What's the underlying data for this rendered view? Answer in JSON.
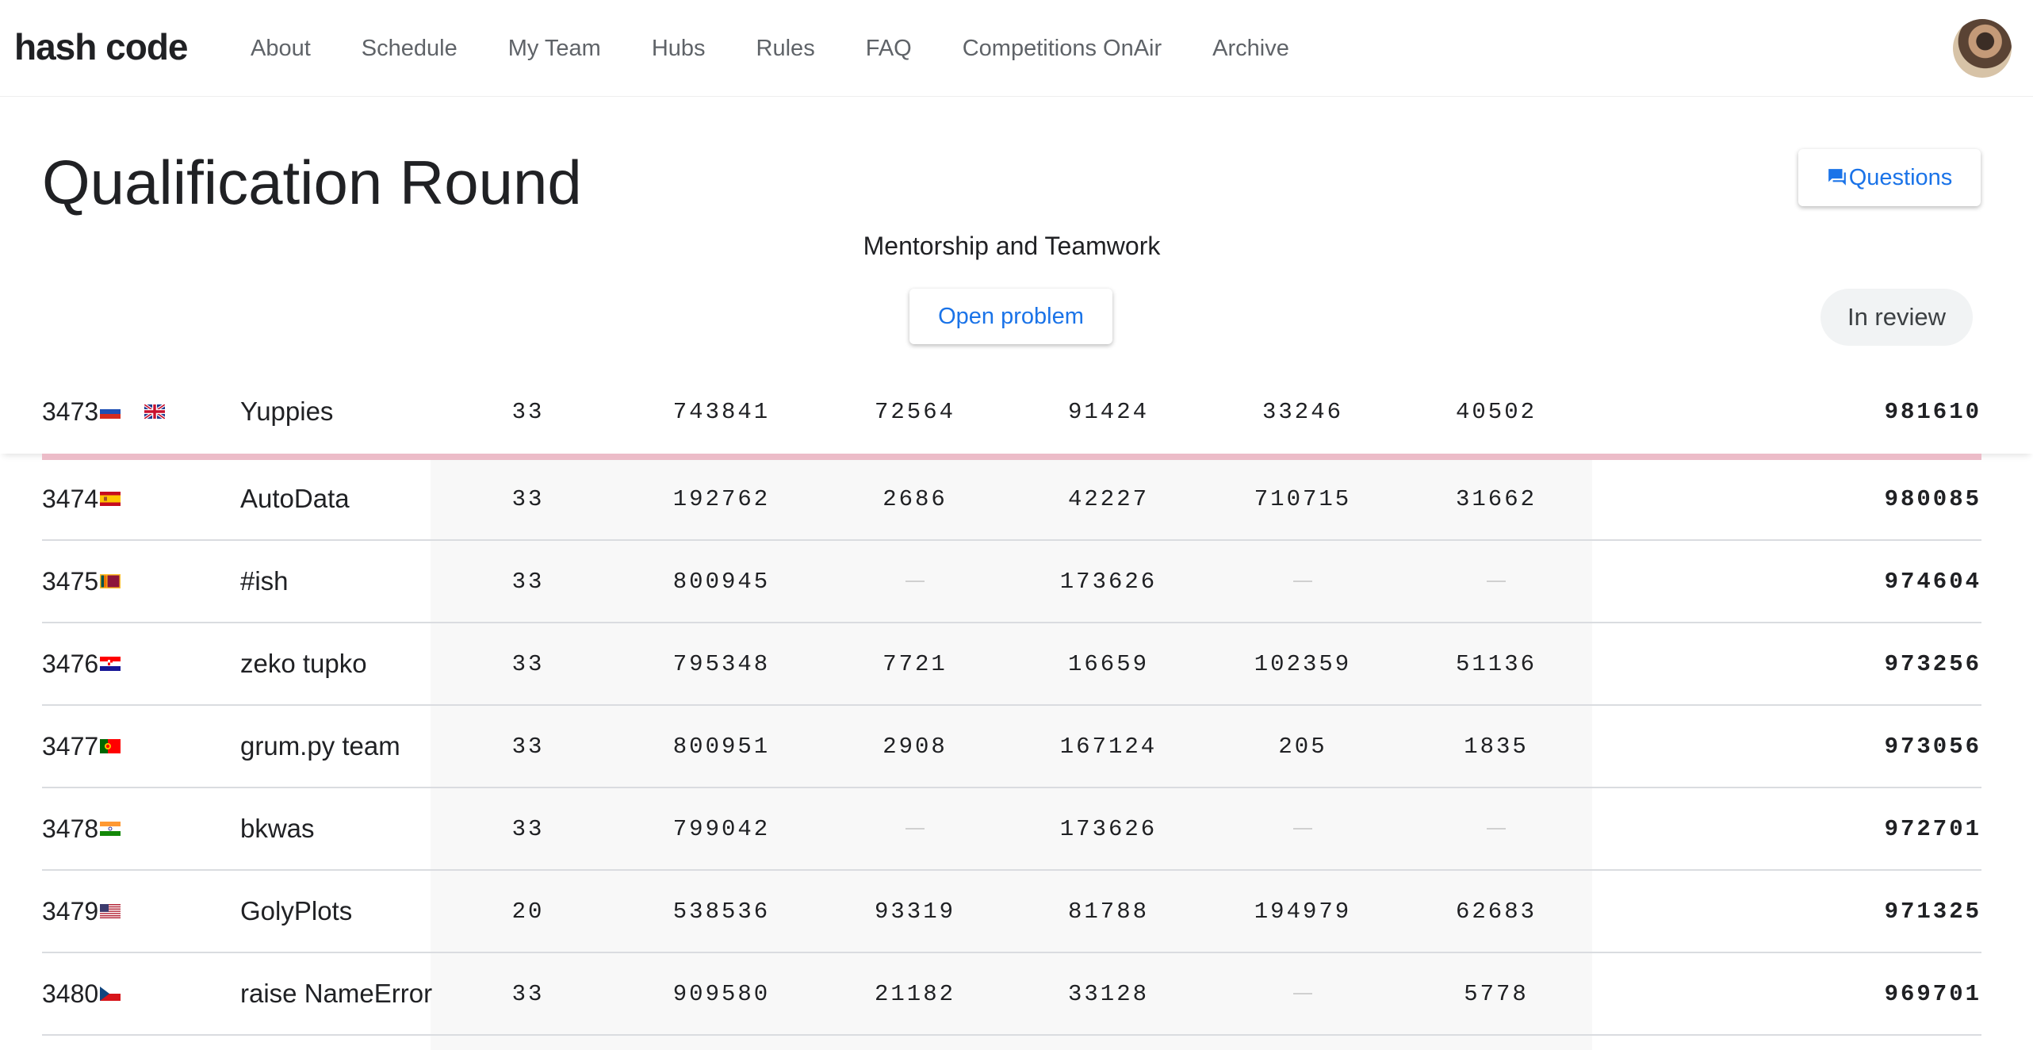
{
  "app": {
    "logo": "hash code",
    "nav": [
      "About",
      "Schedule",
      "My Team",
      "Hubs",
      "Rules",
      "FAQ",
      "Competitions OnAir",
      "Archive"
    ]
  },
  "round": {
    "title": "Qualification Round",
    "subtitle": "Mentorship and Teamwork",
    "questions_label": "Questions",
    "open_problem_label": "Open problem",
    "status": "In review"
  },
  "colors": {
    "accent": "#1a73e8",
    "pinned_divider": "#ecbcc8",
    "score_band": "#f8f8f8"
  },
  "pinned_row": {
    "rank": "3473",
    "flags": [
      "ru",
      "gb"
    ],
    "team": "Yuppies",
    "scores": [
      "33",
      "743841",
      "72564",
      "91424",
      "33246",
      "40502"
    ],
    "total": "981610"
  },
  "rows": [
    {
      "rank": "3474",
      "flags": [
        "es"
      ],
      "team": "AutoData",
      "scores": [
        "33",
        "192762",
        "2686",
        "42227",
        "710715",
        "31662"
      ],
      "total": "980085"
    },
    {
      "rank": "3475",
      "flags": [
        "lk"
      ],
      "team": "#ish",
      "scores": [
        "33",
        "800945",
        "",
        "173626",
        "",
        ""
      ],
      "total": "974604"
    },
    {
      "rank": "3476",
      "flags": [
        "hr"
      ],
      "team": "zeko tupko",
      "scores": [
        "33",
        "795348",
        "7721",
        "16659",
        "102359",
        "51136"
      ],
      "total": "973256"
    },
    {
      "rank": "3477",
      "flags": [
        "pt"
      ],
      "team": "grum.py team",
      "scores": [
        "33",
        "800951",
        "2908",
        "167124",
        "205",
        "1835"
      ],
      "total": "973056"
    },
    {
      "rank": "3478",
      "flags": [
        "in"
      ],
      "team": "bkwas",
      "scores": [
        "33",
        "799042",
        "",
        "173626",
        "",
        ""
      ],
      "total": "972701"
    },
    {
      "rank": "3479",
      "flags": [
        "us"
      ],
      "team": "GolyPlots",
      "scores": [
        "20",
        "538536",
        "93319",
        "81788",
        "194979",
        "62683"
      ],
      "total": "971325"
    },
    {
      "rank": "3480",
      "flags": [
        "cz"
      ],
      "team": "raise NameError",
      "scores": [
        "33",
        "909580",
        "21182",
        "33128",
        "",
        "5778"
      ],
      "total": "969701"
    }
  ]
}
